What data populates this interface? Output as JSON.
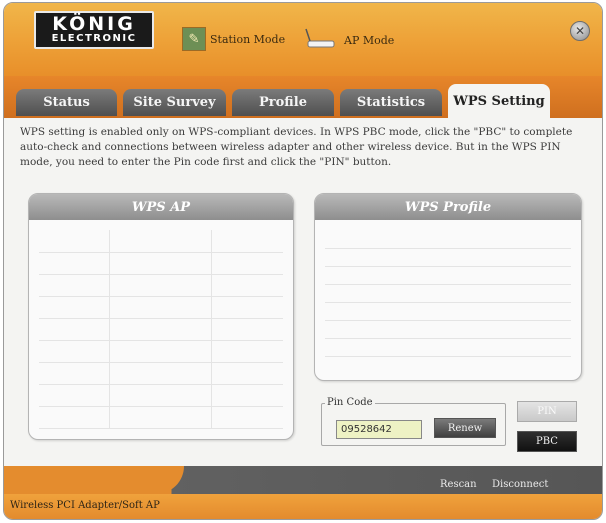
{
  "logo": {
    "brand": "KÖNIG",
    "sub": "ELECTRONIC"
  },
  "modes": {
    "station": "Station Mode",
    "ap": "AP Mode"
  },
  "tabs": [
    "Status",
    "Site Survey",
    "Profile",
    "Statistics",
    "WPS Setting"
  ],
  "active_tab": "WPS Setting",
  "description": "WPS setting is enabled only on WPS-compliant devices. In WPS PBC mode, click the \"PBC\" to complete auto-check and connections between wireless adapter and other wireless device. But in the WPS PIN mode, you need to enter the Pin code first and click the \"PIN\" button.",
  "wps_ap": {
    "title": "WPS AP"
  },
  "wps_profile": {
    "title": "WPS Profile"
  },
  "pin": {
    "label": "Pin Code",
    "value": "09528642",
    "renew_label": "Renew"
  },
  "buttons": {
    "pin": "PIN",
    "pbc": "PBC"
  },
  "links": {
    "rescan": "Rescan",
    "disconnect": "Disconnect"
  },
  "status_bar": {
    "text": "Wireless PCI Adapter/Soft AP"
  },
  "colors": {
    "accent_orange": "#e88f2a",
    "tab_gray": "#5a5a5a",
    "pin_field": "#eef2c4"
  },
  "icons": {
    "close": "close-icon",
    "station": "station-mode-icon",
    "ap": "ap-mode-icon"
  }
}
